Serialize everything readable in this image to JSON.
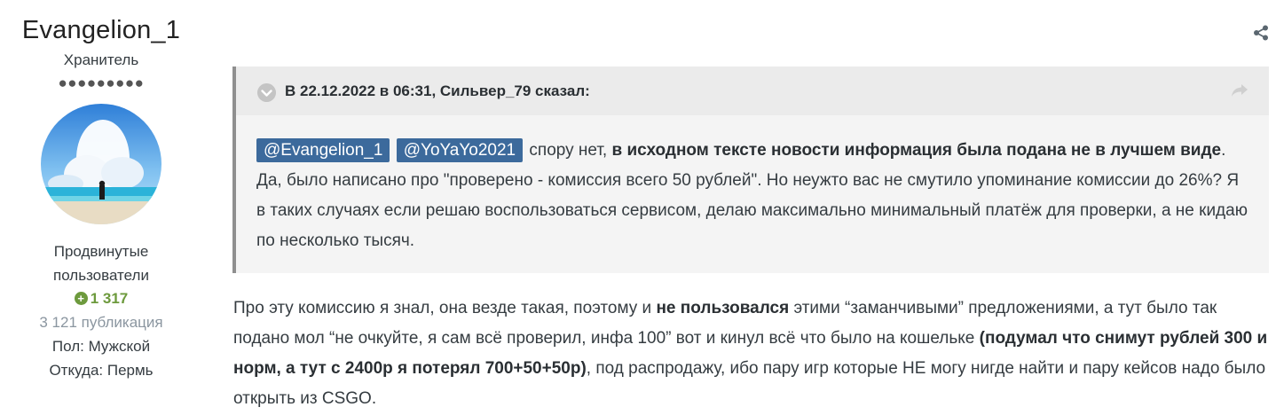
{
  "author": {
    "name": "Evangelion_1",
    "rank": "Хранитель",
    "pips": "●●●●●●●●●",
    "group_line1": "Продвинутые",
    "group_line2": "пользователи",
    "reputation": "1 317",
    "posts": "3 121 публикация",
    "gender": "Пол: Мужской",
    "location": "Откуда: Пермь"
  },
  "quote": {
    "citation": "В 22.12.2022 в 06:31, Сильвер_79 сказал:",
    "mention1": "@Evangelion_1",
    "mention2": "@YoYaYo2021",
    "text_a": " спору нет, ",
    "text_bold": "в исходном тексте новости информация была подана не в лучшем виде",
    "text_b": ". Да, было написано про \"проверено - комиссия всего 50 рублей\". Но неужто вас не смутило упоминание комиссии до 26%? Я в таких случаях если решаю воспользоваться сервисом, делаю максимально минимальный платёж для проверки, а не кидаю по несколько тысяч."
  },
  "post": {
    "part1": "Про эту комиссию я знал, она везде такая, поэтому и ",
    "bold1": "не пользовался",
    "part2": " этими “заманчивыми” предложениями, а тут было так подано мол “не очкуйте, я сам всё проверил, инфа 100” вот и кинул всё что было на кошельке ",
    "bold2": "(подумал что снимут рублей 300 и норм, а тут с 2400р я потерял 700+50+50р)",
    "part3": ", под распродажу, ибо пару игр которые НЕ могу нигде найти и пару кейсов надо было открыть из CSGO."
  },
  "icons": {
    "share": "share-icon",
    "toggle": "chevron-down-icon",
    "goto": "reply-arrow-icon"
  },
  "colors": {
    "mention_bg": "#3c6a9c",
    "reputation": "#6d9a3d",
    "quote_border": "#8f8f8f"
  }
}
